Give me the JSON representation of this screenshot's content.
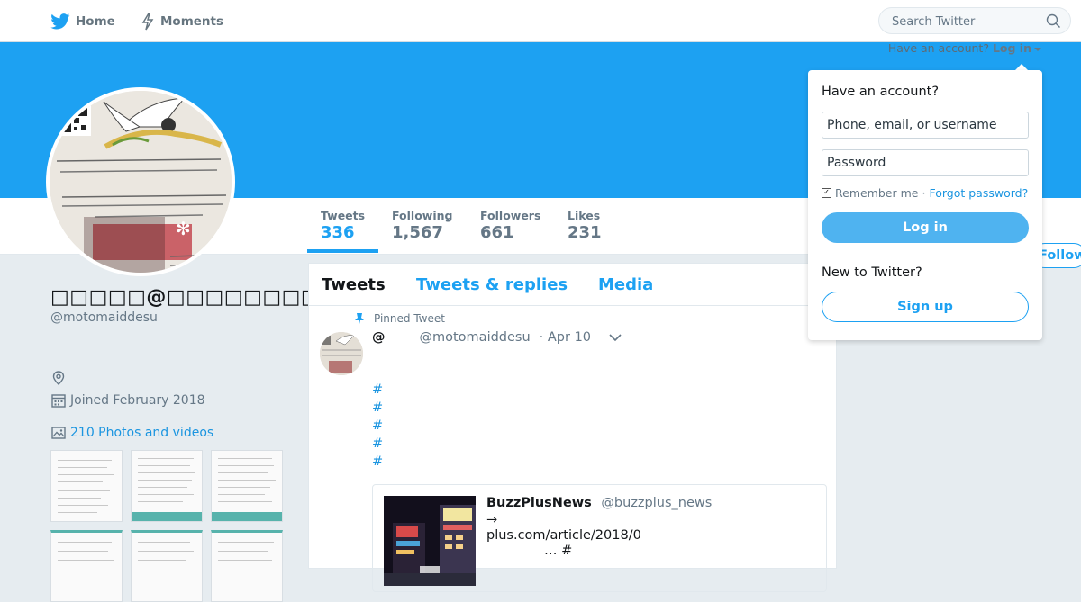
{
  "nav": {
    "home_label": "Home",
    "moments_label": "Moments",
    "search_placeholder": "Search Twitter"
  },
  "login_menu": {
    "prompt_text": "Have an account?",
    "login_label": "Log in"
  },
  "stats": [
    {
      "label": "Tweets",
      "value": "336"
    },
    {
      "label": "Following",
      "value": "1,567"
    },
    {
      "label": "Followers",
      "value": "661"
    },
    {
      "label": "Likes",
      "value": "231"
    }
  ],
  "follow_label": "Follow",
  "profile": {
    "display_name": "□□□□□@□□□□□□□□□□□",
    "handle": "@motomaiddesu",
    "joined": "Joined February 2018",
    "photos_link": "210 Photos and videos"
  },
  "timeline": {
    "tabs": [
      "Tweets",
      "Tweets & replies",
      "Media"
    ],
    "pinned_label": "Pinned Tweet",
    "tweet": {
      "at": "@",
      "handle": "@motomaiddesu",
      "date": "· Apr 10",
      "hashtags": [
        "#",
        "#",
        "#",
        "#",
        "#"
      ],
      "card": {
        "name": "BuzzPlusNews",
        "screen_name": "@buzzplus_news",
        "line1": "→",
        "line2": "plus.com/article/2018/0",
        "line3": "… #"
      }
    }
  },
  "login_dropdown": {
    "heading": "Have an account?",
    "username_placeholder": "Phone, email, or username",
    "password_placeholder": "Password",
    "remember_label": "Remember me",
    "forgot_label": "Forgot password?",
    "login_button": "Log in",
    "new_heading": "New to Twitter?",
    "signup_button": "Sign up"
  },
  "colors": {
    "brand_blue": "#1da1f2",
    "login_button": "#4fb3f0",
    "background": "#e6ecf0"
  }
}
